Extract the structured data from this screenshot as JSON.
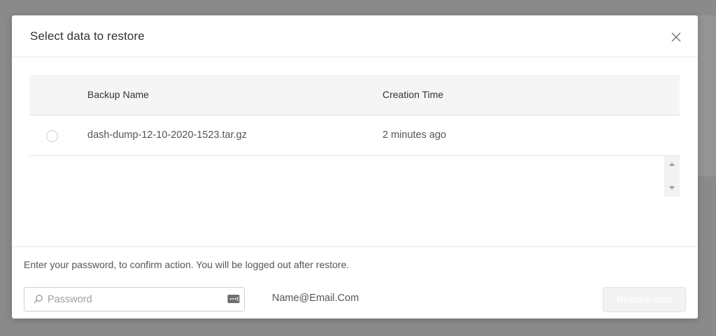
{
  "dialog": {
    "title": "Select data to restore",
    "close_icon": "close-icon"
  },
  "table": {
    "columns": [
      "Backup Name",
      "Creation Time"
    ],
    "rows": [
      {
        "name": "dash-dump-12-10-2020-1523.tar.gz",
        "time": "2 minutes ago",
        "selected": false
      }
    ]
  },
  "footer": {
    "confirm_text": "Enter your password, to confirm action. You will be logged out after restore.",
    "password": {
      "placeholder": "Password",
      "value": "",
      "search_icon": "search-icon",
      "key_icon": "password-manager-icon"
    },
    "email": "Name@Email.Com",
    "restore_label": "Restore data",
    "restore_enabled": false
  }
}
